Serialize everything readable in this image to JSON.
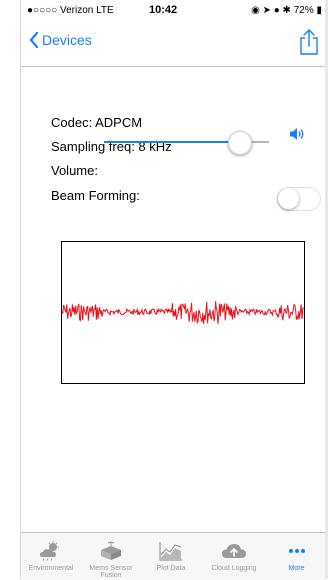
{
  "status": {
    "carrier": "●○○○○ Verizon  LTE",
    "time": "10:42",
    "battery": "◉ ➤ ● ✱ 72% ▮"
  },
  "nav": {
    "back_label": "Devices"
  },
  "audio": {
    "codec": "Codec: ADPCM",
    "sampling": "Sampling freq: 8 kHz",
    "volume_label": "Volume:",
    "volume_level": 0.8,
    "beam_label": "Beam Forming:",
    "beam_on": false
  },
  "tabs": [
    {
      "label": "Environmental",
      "icon": "weather-icon"
    },
    {
      "label": "Mems Sensor Fusion",
      "icon": "cube-icon"
    },
    {
      "label": "Plot Data",
      "icon": "plot-icon"
    },
    {
      "label": "Cloud Logging",
      "icon": "cloud-upload-icon"
    },
    {
      "label": "More",
      "icon": "more-icon"
    }
  ],
  "colors": {
    "accent": "#1a7ff5",
    "waveform": "#e8101a"
  }
}
